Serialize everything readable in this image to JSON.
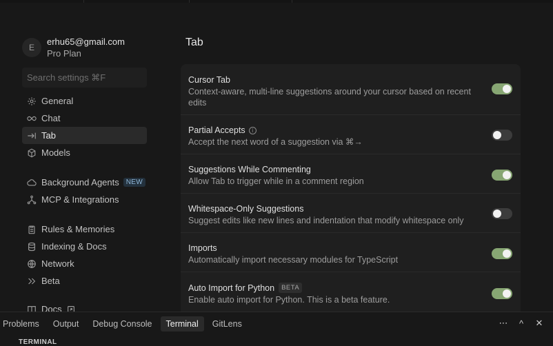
{
  "account": {
    "avatar_initial": "E",
    "email": "erhu65@gmail.com",
    "plan": "Pro Plan"
  },
  "search": {
    "placeholder": "Search settings ⌘F"
  },
  "nav": {
    "group1": [
      {
        "label": "General",
        "icon": "gear-icon"
      },
      {
        "label": "Chat",
        "icon": "infinity-icon"
      },
      {
        "label": "Tab",
        "icon": "tab-arrow-icon",
        "active": true
      },
      {
        "label": "Models",
        "icon": "cube-icon"
      }
    ],
    "group2": [
      {
        "label": "Background Agents",
        "icon": "cloud-icon",
        "badge": "NEW"
      },
      {
        "label": "MCP & Integrations",
        "icon": "network-nodes-icon"
      }
    ],
    "group3": [
      {
        "label": "Rules & Memories",
        "icon": "clipboard-icon"
      },
      {
        "label": "Indexing & Docs",
        "icon": "database-icon"
      },
      {
        "label": "Network",
        "icon": "globe-icon"
      },
      {
        "label": "Beta",
        "icon": "chevrons-right-icon"
      }
    ],
    "group4": [
      {
        "label": "Docs",
        "icon": "book-icon",
        "trailing_icon": "external-link-icon"
      }
    ]
  },
  "main": {
    "title": "Tab",
    "settings": [
      {
        "title": "Cursor Tab",
        "description": "Context-aware, multi-line suggestions around your cursor based on recent edits",
        "enabled": true
      },
      {
        "title": "Partial Accepts",
        "description": "Accept the next word of a suggestion via ⌘→",
        "enabled": false,
        "info_icon": "info-icon",
        "info_glyph": "i"
      },
      {
        "title": "Suggestions While Commenting",
        "description": "Allow Tab to trigger while in a comment region",
        "enabled": true
      },
      {
        "title": "Whitespace-Only Suggestions",
        "description": "Suggest edits like new lines and indentation that modify whitespace only",
        "enabled": false
      },
      {
        "title": "Imports",
        "description": "Automatically import necessary modules for TypeScript",
        "enabled": true
      },
      {
        "title": "Auto Import for Python",
        "description": "Enable auto import for Python. This is a beta feature.",
        "enabled": true,
        "badge": "BETA"
      }
    ]
  },
  "panel": {
    "tabs": [
      {
        "label": "Problems"
      },
      {
        "label": "Output"
      },
      {
        "label": "Debug Console"
      },
      {
        "label": "Terminal",
        "active": true
      },
      {
        "label": "GitLens"
      }
    ],
    "actions": [
      {
        "name": "more-icon",
        "glyph": "⋯"
      },
      {
        "name": "chevron-up-icon",
        "glyph": "^"
      },
      {
        "name": "close-icon",
        "glyph": "✕"
      }
    ],
    "section_label": "TERMINAL"
  },
  "colors": {
    "toggle_on": "#87a673",
    "toggle_off": "#3c3c3c",
    "background": "#181818",
    "card": "#1f1f1f"
  }
}
